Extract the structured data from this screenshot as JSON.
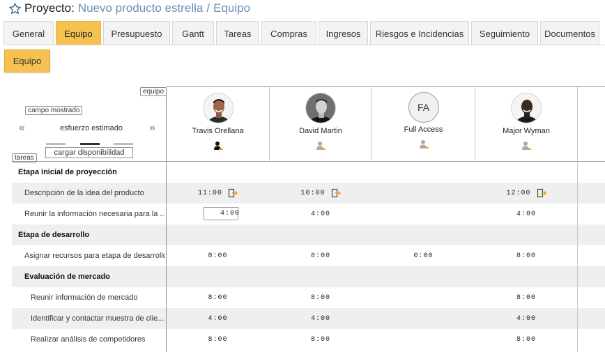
{
  "header": {
    "label": "Proyecto:",
    "project": "Nuevo producto estrella",
    "separator": "/",
    "section": "Equipo"
  },
  "tabs": [
    {
      "label": "General",
      "active": false
    },
    {
      "label": "Equipo",
      "active": true
    },
    {
      "label": "Presupuesto",
      "active": false
    },
    {
      "label": "Gantt",
      "active": false
    },
    {
      "label": "Tareas",
      "active": false
    },
    {
      "label": "Compras",
      "active": false
    },
    {
      "label": "Ingresos",
      "active": false
    },
    {
      "label": "Riesgos e Incidencias",
      "active": false
    },
    {
      "label": "Seguimiento",
      "active": false
    },
    {
      "label": "Documentos",
      "active": false
    }
  ],
  "subtab": {
    "label": "Equipo"
  },
  "grid": {
    "team_tag": "equipo",
    "field_tag": "campo mostrado",
    "tasks_tag": "tareas",
    "display_value": "esfuerzo estimado",
    "prev_arrow": "«",
    "next_arrow": "»",
    "load_button": "cargar disponibilidad",
    "members": [
      {
        "name": "Travis Orellana",
        "avatar": "photo",
        "role_icon": "person-icon"
      },
      {
        "name": "David Martin",
        "avatar": "photo",
        "role_icon": "person-icon"
      },
      {
        "name": "Full Access",
        "avatar": "FA",
        "role_icon": "person-icon"
      },
      {
        "name": "Major Wyman",
        "avatar": "photo",
        "role_icon": "person-icon"
      }
    ],
    "rows": [
      {
        "label": "Etapa inicial de proyección",
        "type": "phase",
        "values": [
          "",
          "",
          "",
          ""
        ]
      },
      {
        "label": "Descripción de la idea del producto",
        "type": "task",
        "values": [
          "11:00",
          "10:00",
          "",
          "12:00"
        ],
        "exit": [
          true,
          true,
          false,
          true
        ]
      },
      {
        "label": "Reunir la información necesaria para la ...",
        "type": "task",
        "values": [
          "4:00",
          "4:00",
          "",
          "4:00"
        ],
        "editing": 0
      },
      {
        "label": "Etapa de desarrollo",
        "type": "phase",
        "values": [
          "",
          "",
          "",
          ""
        ]
      },
      {
        "label": "Asignar recursos para etapa de desarrollo",
        "type": "task",
        "values": [
          "8:00",
          "8:00",
          "0:00",
          "8:00"
        ]
      },
      {
        "label": "Evaluación de mercado",
        "type": "subphase",
        "values": [
          "",
          "",
          "",
          ""
        ]
      },
      {
        "label": "Reunir información de mercado",
        "type": "subtask",
        "values": [
          "8:00",
          "8:00",
          "",
          "8:00"
        ]
      },
      {
        "label": "Identificar y contactar muestra de clie...",
        "type": "subtask",
        "values": [
          "4:00",
          "4:00",
          "",
          "4:00"
        ]
      },
      {
        "label": "Realizar análisis de competidores",
        "type": "subtask",
        "values": [
          "8:00",
          "8:00",
          "",
          "8:00"
        ]
      }
    ]
  },
  "colors": {
    "accent": "#f5c251",
    "link": "#6b8fb4",
    "shade": "#efefef"
  }
}
